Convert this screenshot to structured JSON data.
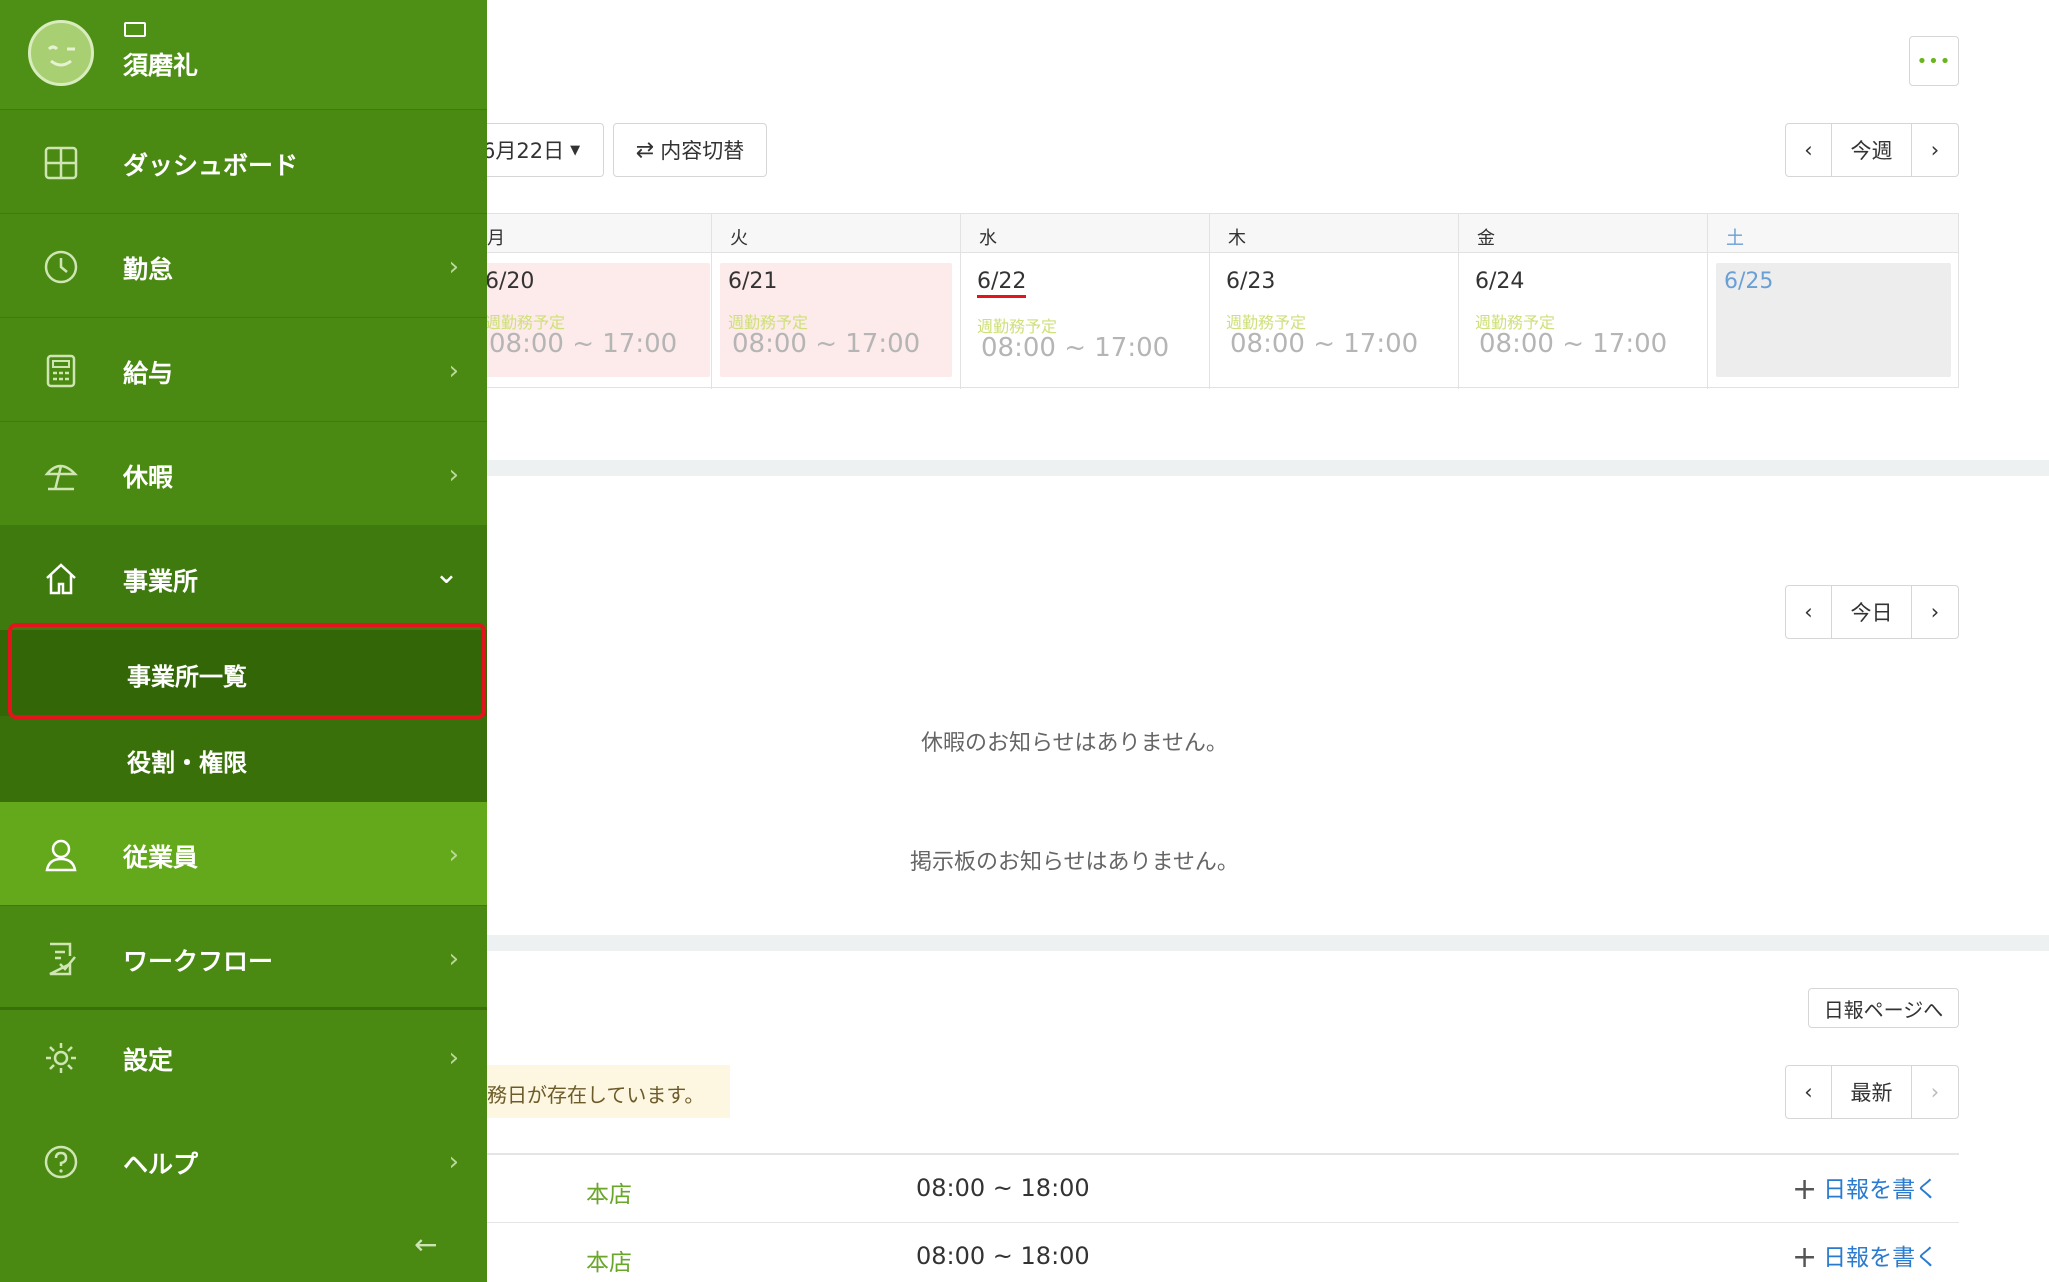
{
  "user": {
    "name": "須磨礼"
  },
  "nav": {
    "items": [
      {
        "label": "ダッシュボード",
        "icon": "dashboard-icon"
      },
      {
        "label": "勤怠",
        "icon": "clock-icon"
      },
      {
        "label": "給与",
        "icon": "calculator-icon"
      },
      {
        "label": "休暇",
        "icon": "beach-umbrella-icon"
      },
      {
        "label": "事業所",
        "icon": "home-icon"
      },
      {
        "label": "従業員",
        "icon": "person-icon"
      },
      {
        "label": "ワークフロー",
        "icon": "checklist-icon"
      },
      {
        "label": "設定",
        "icon": "gear-icon"
      },
      {
        "label": "ヘルプ",
        "icon": "help-icon"
      }
    ],
    "office_sub": [
      "事業所一覧",
      "役割・権限"
    ]
  },
  "header": {
    "more_label": "•••"
  },
  "schedule": {
    "date_select": "6月22日",
    "switch_label": "内容切替",
    "prev": "‹",
    "current": "今週",
    "next": "›",
    "days": [
      {
        "head": "月",
        "date": "6/20",
        "label": "週勤務予定",
        "time": "08:00 ~ 17:00"
      },
      {
        "head": "火",
        "date": "6/21",
        "label": "週勤務予定",
        "time": "08:00 ~ 17:00"
      },
      {
        "head": "水",
        "date": "6/22",
        "label": "週勤務予定",
        "time": "08:00 ~ 17:00"
      },
      {
        "head": "木",
        "date": "6/23",
        "label": "週勤務予定",
        "time": "08:00 ~ 17:00"
      },
      {
        "head": "金",
        "date": "6/24",
        "label": "週勤務予定",
        "time": "08:00 ~ 17:00"
      },
      {
        "head": "土",
        "date": "6/25",
        "label": "",
        "time": ""
      }
    ]
  },
  "notices": {
    "today_label": "今日",
    "leave_empty": "休暇のお知らせはありません。",
    "board_empty": "掲示板のお知らせはありません。"
  },
  "reports": {
    "page_link": "日報ページへ",
    "latest_label": "最新",
    "warning": "務日が存在しています。",
    "rows": [
      {
        "store": "本店",
        "time": "08:00 ~ 18:00",
        "action": "日報を書く"
      },
      {
        "store": "本店",
        "time": "08:00 ~ 18:00",
        "action": "日報を書く"
      }
    ]
  },
  "colors": {
    "sidebar": "#4a8a12",
    "active": "#64a91c",
    "highlight": "#e3141c",
    "link": "#2a7bd0"
  }
}
